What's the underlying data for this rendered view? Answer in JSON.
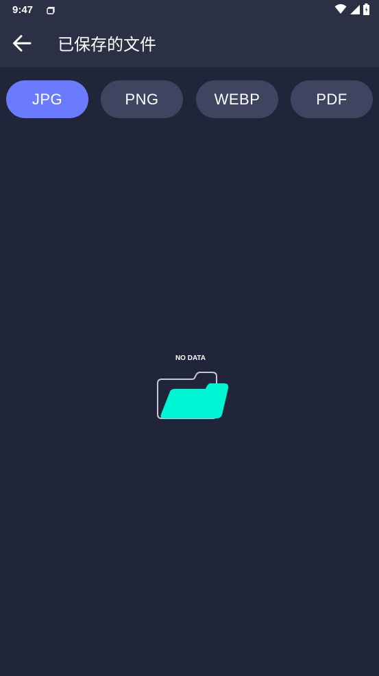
{
  "status_bar": {
    "time": "9:47"
  },
  "app_bar": {
    "title": "已保存的文件",
    "back_icon": "arrow-left-icon"
  },
  "tabs": [
    {
      "label": "JPG",
      "active": true
    },
    {
      "label": "PNG",
      "active": false
    },
    {
      "label": "WEBP",
      "active": false
    },
    {
      "label": "PDF",
      "active": false
    }
  ],
  "empty_state": {
    "text": "NO DATA",
    "icon": "folder-icon"
  },
  "colors": {
    "background": "#212539",
    "bar": "#2c3044",
    "tab_inactive": "#3f4461",
    "tab_active": "#6b7bff",
    "folder_accent": "#00f5d4"
  }
}
